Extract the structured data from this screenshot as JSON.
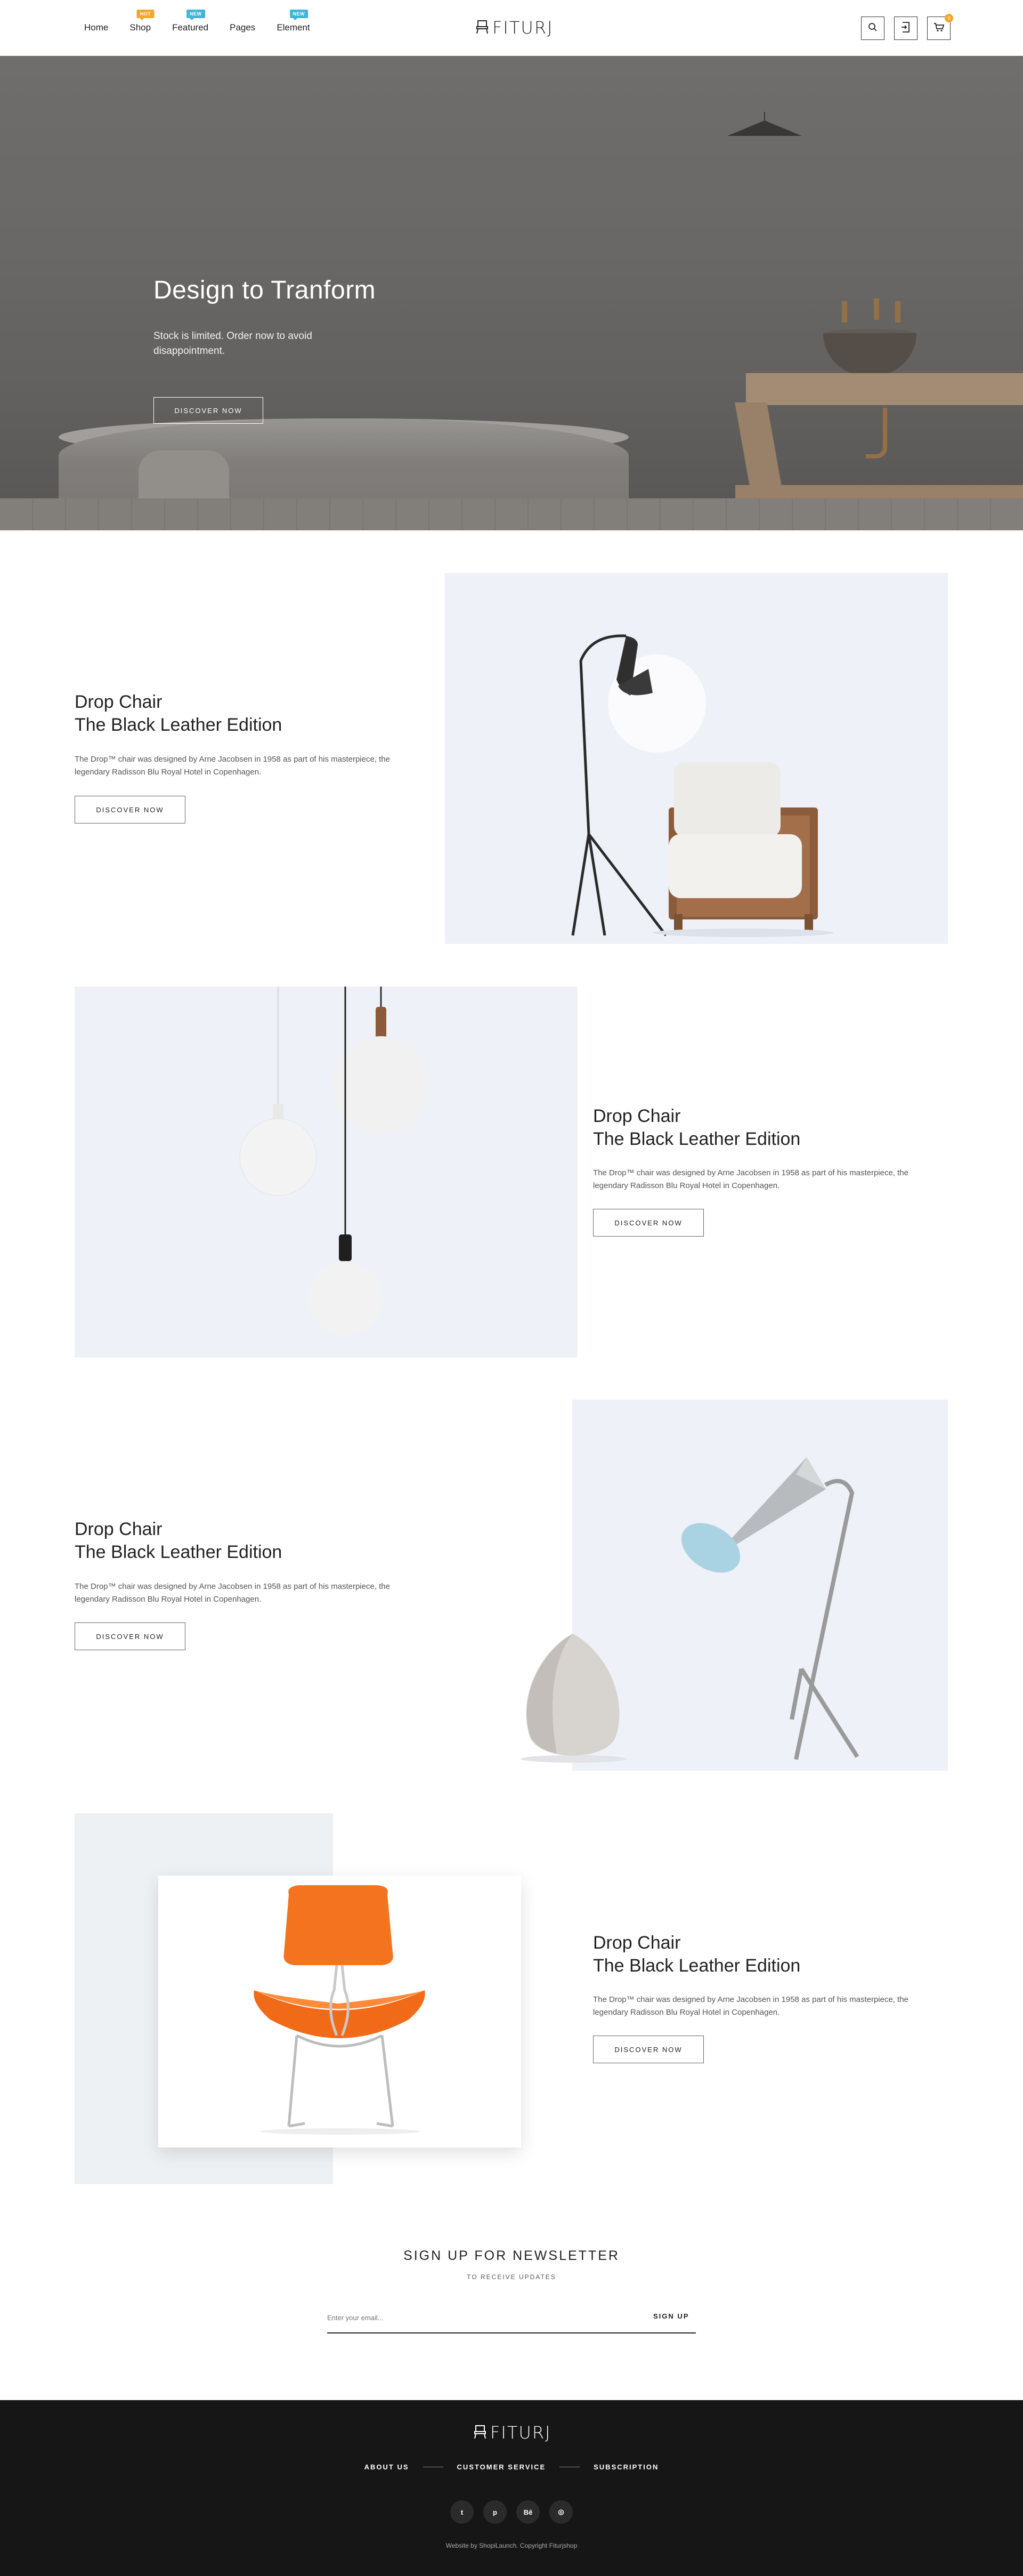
{
  "nav": {
    "items": [
      {
        "label": "Home",
        "badge": ""
      },
      {
        "label": "Shop",
        "badge": "HOT",
        "badge_color": "#f0a72a"
      },
      {
        "label": "Featured",
        "badge": "NEW",
        "badge_color": "#3fb5d9"
      },
      {
        "label": "Pages",
        "badge": ""
      },
      {
        "label": "Element",
        "badge": "NEW",
        "badge_color": "#3fb5d9"
      }
    ]
  },
  "header": {
    "logo_text": "FITURJ",
    "icons": [
      "search-icon",
      "login-icon",
      "cart-icon"
    ],
    "cart_count": "0"
  },
  "hero": {
    "title": "Design to Tranform",
    "subtitle": "Stock is limited. Order now to avoid disappointment.",
    "button": "DISCOVER NOW"
  },
  "products": [
    {
      "title_line1": "Drop Chair",
      "title_line2": "The Black Leather Edition",
      "description": "The Drop™ chair was designed by Arne Jacobsen in 1958 as part of his masterpiece, the legendary Radisson Blu Royal Hotel in Copenhagen.",
      "button": "DISCOVER NOW"
    },
    {
      "title_line1": "Drop Chair",
      "title_line2": "The Black Leather Edition",
      "description": "The Drop™ chair was designed by Arne Jacobsen in 1958 as part of his masterpiece, the legendary Radisson Blu Royal Hotel in Copenhagen.",
      "button": "DISCOVER NOW"
    },
    {
      "title_line1": "Drop Chair",
      "title_line2": "The Black Leather Edition",
      "description": "The Drop™ chair was designed by Arne Jacobsen in 1958 as part of his masterpiece, the legendary Radisson Blu Royal Hotel in Copenhagen.",
      "button": "DISCOVER NOW"
    },
    {
      "title_line1": "Drop Chair",
      "title_line2": "The Black Leather Edition",
      "description": "The Drop™ chair was designed by Arne Jacobsen in 1958 as part of his masterpiece, the legendary Radisson Blu Royal Hotel in Copenhagen.",
      "button": "DISCOVER NOW"
    }
  ],
  "newsletter": {
    "title": "SIGN UP FOR NEWSLETTER",
    "subtitle": "TO RECEIVE UPDATES",
    "placeholder": "Enter your email...",
    "button": "SIGN UP"
  },
  "footer": {
    "logo_text": "FITURJ",
    "links": [
      "ABOUT US",
      "CUSTOMER SERVICE",
      "SUBSCRIPTION"
    ],
    "social": [
      {
        "icon": "twitter-icon",
        "glyph": "t"
      },
      {
        "icon": "pinterest-icon",
        "glyph": "p"
      },
      {
        "icon": "behance-icon",
        "glyph": "Bē"
      },
      {
        "icon": "instagram-icon",
        "glyph": "◎"
      }
    ],
    "copyright": "Website by ShopiLaunch. Copyright Fiturjshop"
  },
  "colors": {
    "accent": "#f0a72a",
    "badge_new": "#3fb5d9",
    "footer_bg": "#161616",
    "product_bg": "#eef1f7"
  }
}
